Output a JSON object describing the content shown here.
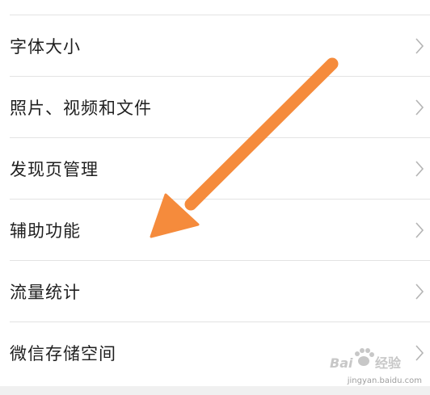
{
  "settings": {
    "items": [
      {
        "label": "字体大小"
      },
      {
        "label": "照片、视频和文件"
      },
      {
        "label": "发现页管理"
      },
      {
        "label": "辅助功能"
      },
      {
        "label": "流量统计"
      },
      {
        "label": "微信存储空间"
      }
    ]
  },
  "annotation": {
    "arrow_color": "#f58b3c"
  },
  "watermark": {
    "logo_text": "Baidu经验",
    "url": "jingyan.baidu.com"
  }
}
